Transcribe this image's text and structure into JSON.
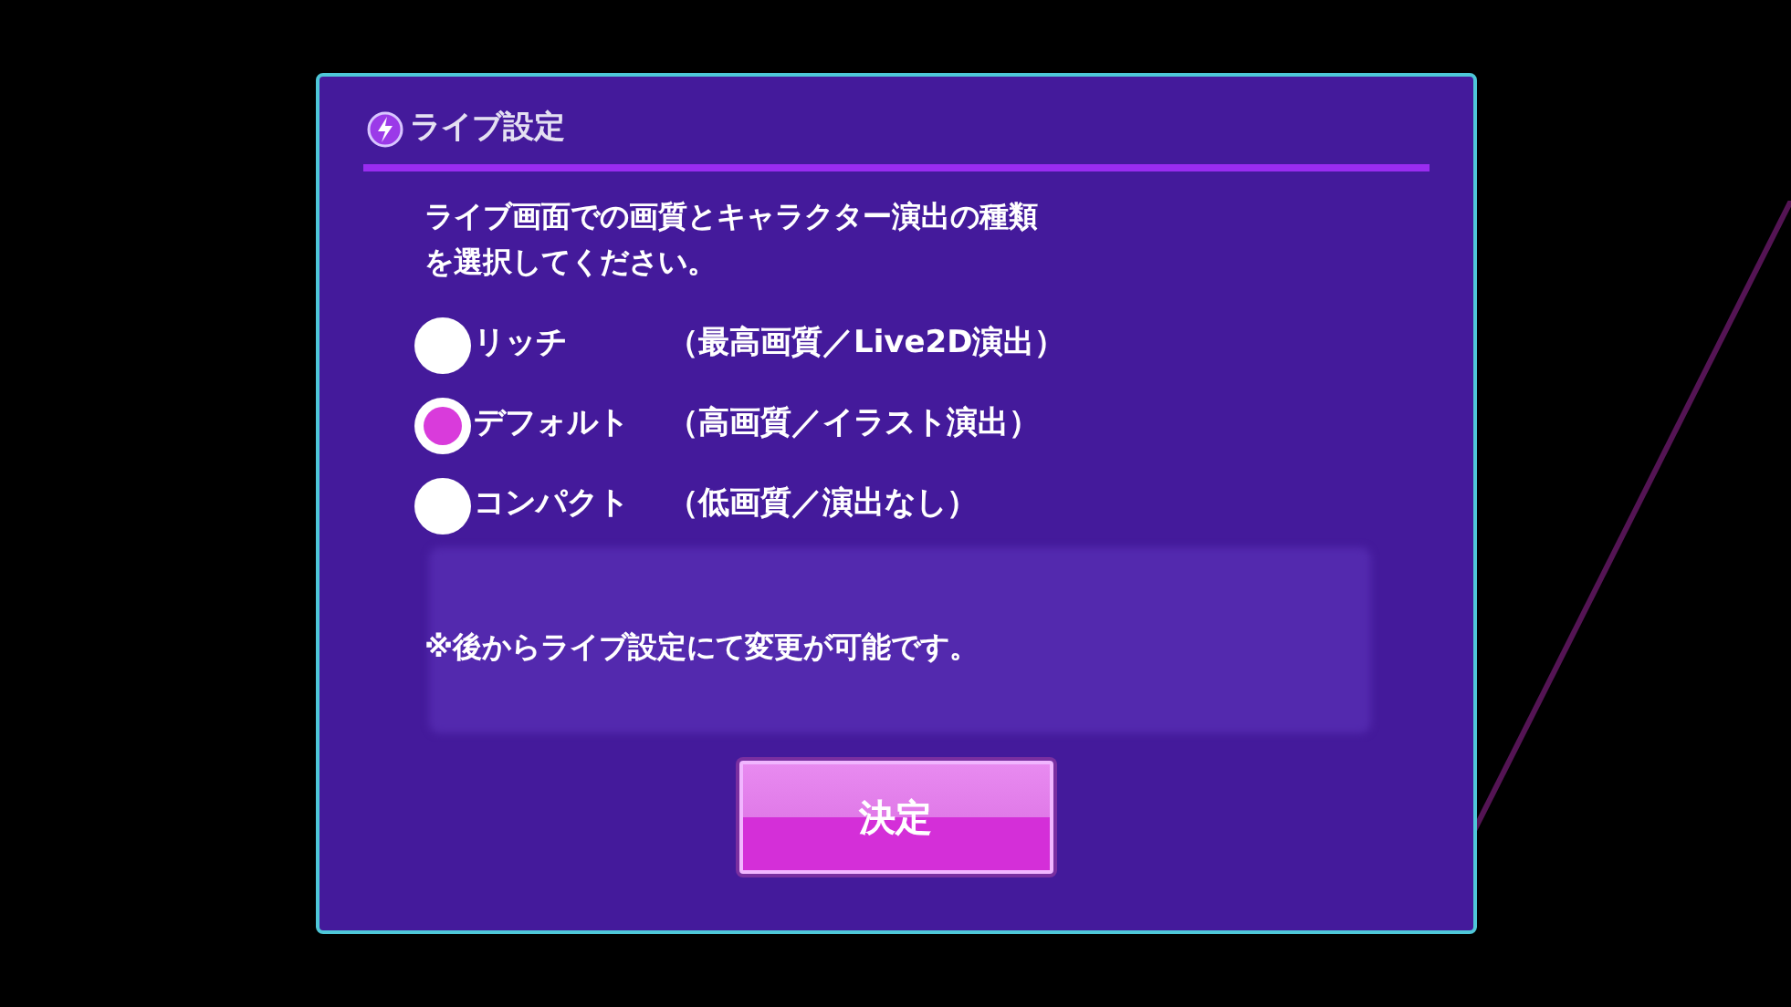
{
  "dialog": {
    "title": "ライブ設定",
    "message_lines": [
      "ライブ画面での画質とキャラクター演出の種類",
      "を選択してください。"
    ],
    "options": [
      {
        "label": "リッチ",
        "detail": "（最高画質／Live2D演出）",
        "selected": false
      },
      {
        "label": "デフォルト",
        "detail": "（高画質／イラスト演出）",
        "selected": true
      },
      {
        "label": "コンパクト",
        "detail": "（低画質／演出なし）",
        "selected": false
      }
    ],
    "note": "※後からライブ設定にて変更が可能です。",
    "confirm_button": "決定"
  }
}
